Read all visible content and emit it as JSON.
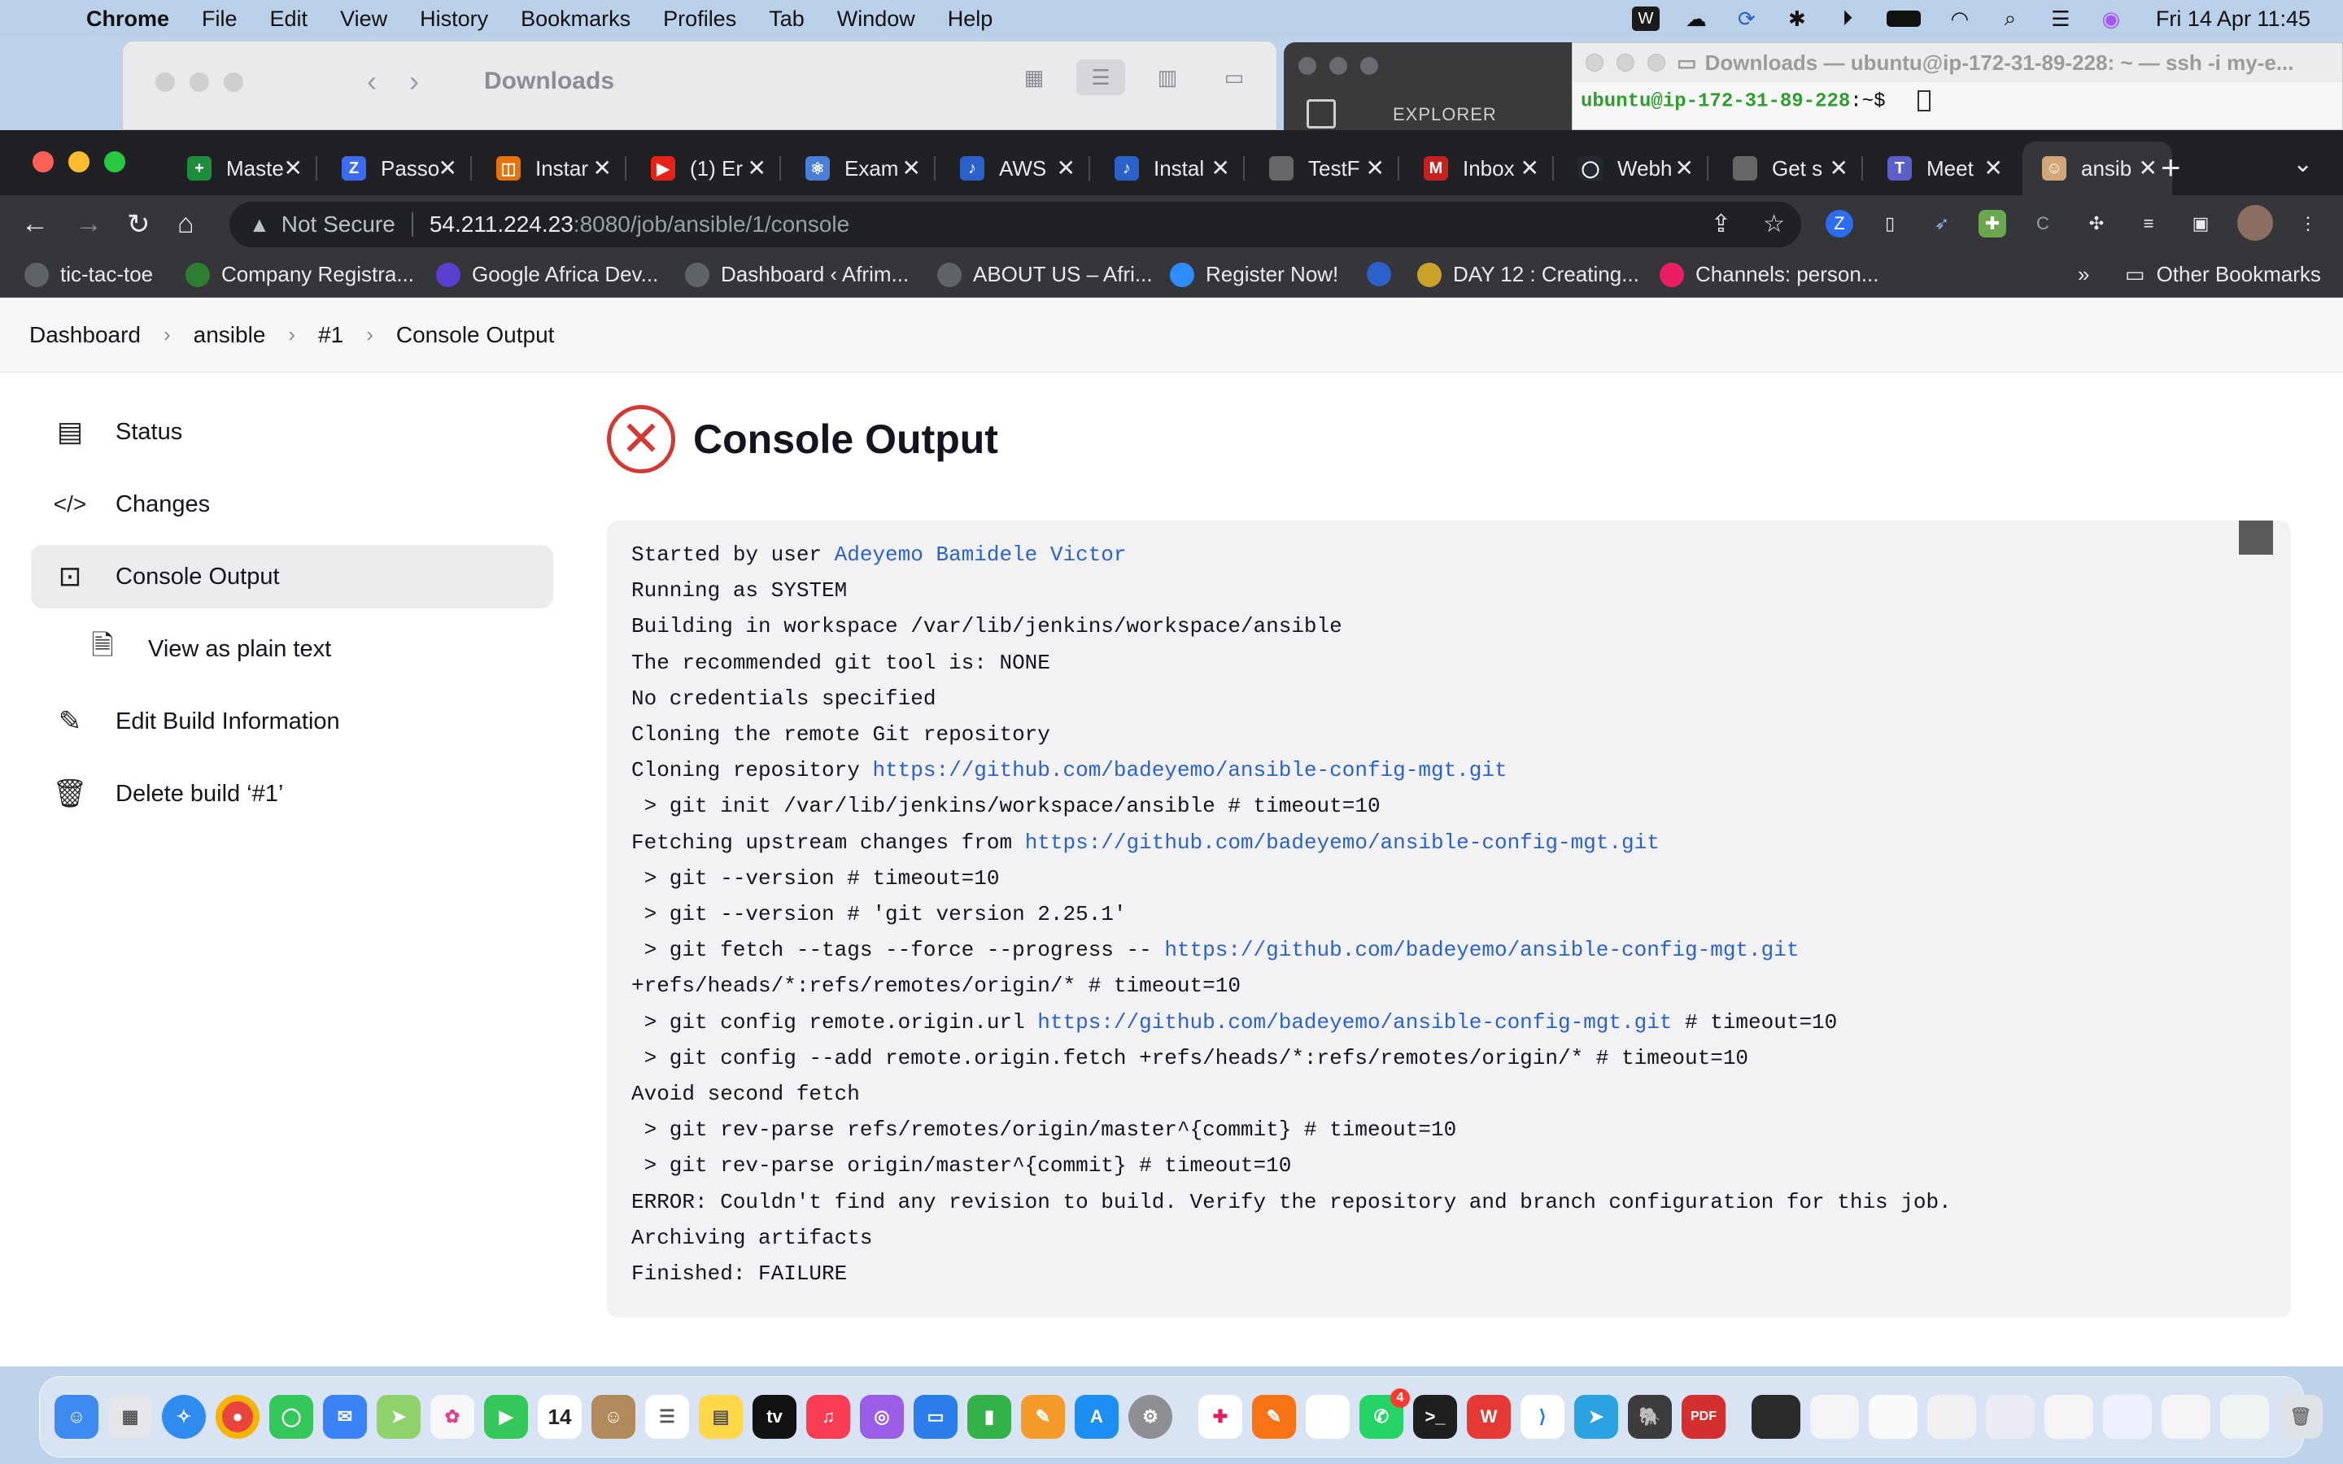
{
  "menubar": {
    "app": "Chrome",
    "items": [
      "File",
      "Edit",
      "View",
      "History",
      "Bookmarks",
      "Profiles",
      "Tab",
      "Window",
      "Help"
    ],
    "clock": "Fri 14 Apr  11:45"
  },
  "finder": {
    "title": "Downloads"
  },
  "vscode": {
    "explorer": "EXPLORER"
  },
  "terminal": {
    "title": "Downloads — ubuntu@ip-172-31-89-228: ~ — ssh -i my-e...",
    "prompt_user": "ubuntu@ip-172-31-89-228",
    "prompt_rest": ":~$"
  },
  "tabs": [
    {
      "label": "Maste",
      "color": "#1e8e3e",
      "glyph": "+"
    },
    {
      "label": "Passo",
      "color": "#3d6cf0",
      "glyph": "Z"
    },
    {
      "label": "Instar",
      "color": "#e8710a",
      "glyph": "◫"
    },
    {
      "label": "(1) Er",
      "color": "#e62117",
      "glyph": "▶"
    },
    {
      "label": "Exam",
      "color": "#4a7fd8",
      "glyph": "⚛"
    },
    {
      "label": "AWS",
      "color": "#2a62c9",
      "glyph": "♪"
    },
    {
      "label": "Instal",
      "color": "#2a62c9",
      "glyph": "♪"
    },
    {
      "label": "TestF",
      "color": "#666666",
      "glyph": ""
    },
    {
      "label": "Inbox",
      "color": "#c5221f",
      "glyph": "M"
    },
    {
      "label": "Webh",
      "color": "#24292f",
      "glyph": "◯"
    },
    {
      "label": "Get s",
      "color": "#666666",
      "glyph": ""
    },
    {
      "label": "Meet",
      "color": "#5b5fc7",
      "glyph": "T"
    },
    {
      "label": "ansib",
      "color": "#d2a679",
      "glyph": "☺"
    }
  ],
  "omnibox": {
    "security": "Not Secure",
    "host": "54.211.224.23",
    "path": ":8080/job/ansible/1/console"
  },
  "bookmarks": [
    {
      "label": "tic-tac-toe",
      "color": "#5f6368"
    },
    {
      "label": "Company Registra...",
      "color": "#2e7d32"
    },
    {
      "label": "Google Africa Dev...",
      "color": "#5b3fd1"
    },
    {
      "label": "Dashboard ‹ Afrim...",
      "color": "#5f6368"
    },
    {
      "label": "ABOUT US – Afri...",
      "color": "#5f6368"
    },
    {
      "label": "Register Now!",
      "color": "#2d8cff"
    },
    {
      "label": "",
      "color": "#2a62c9"
    },
    {
      "label": "DAY 12 : Creating...",
      "color": "#c9a227"
    },
    {
      "label": "Channels: person...",
      "color": "#e91e63"
    }
  ],
  "bookmarks_more": "»",
  "other_bookmarks": "Other Bookmarks",
  "breadcrumbs": [
    "Dashboard",
    "ansible",
    "#1",
    "Console Output"
  ],
  "sidebar": [
    {
      "label": "Status",
      "icon": "document-icon"
    },
    {
      "label": "Changes",
      "icon": "code-icon"
    },
    {
      "label": "Console Output",
      "icon": "terminal-icon"
    },
    {
      "label": "View as plain text",
      "icon": "file-icon"
    },
    {
      "label": "Edit Build Information",
      "icon": "edit-icon"
    },
    {
      "label": "Delete build ‘#1’",
      "icon": "trash-icon"
    }
  ],
  "page_title": "Console Output",
  "console_lines": [
    {
      "pre": "Started by user ",
      "link": "Adeyemo Bamidele Victor",
      "post": ""
    },
    {
      "pre": "Running as SYSTEM",
      "link": "",
      "post": ""
    },
    {
      "pre": "Building in workspace /var/lib/jenkins/workspace/ansible",
      "link": "",
      "post": ""
    },
    {
      "pre": "The recommended git tool is: NONE",
      "link": "",
      "post": ""
    },
    {
      "pre": "No credentials specified",
      "link": "",
      "post": ""
    },
    {
      "pre": "Cloning the remote Git repository",
      "link": "",
      "post": ""
    },
    {
      "pre": "Cloning repository ",
      "link": "https://github.com/badeyemo/ansible-config-mgt.git",
      "post": ""
    },
    {
      "pre": " > git init /var/lib/jenkins/workspace/ansible # timeout=10",
      "link": "",
      "post": ""
    },
    {
      "pre": "Fetching upstream changes from ",
      "link": "https://github.com/badeyemo/ansible-config-mgt.git",
      "post": ""
    },
    {
      "pre": " > git --version # timeout=10",
      "link": "",
      "post": ""
    },
    {
      "pre": " > git --version # 'git version 2.25.1'",
      "link": "",
      "post": ""
    },
    {
      "pre": " > git fetch --tags --force --progress -- ",
      "link": "https://github.com/badeyemo/ansible-config-mgt.git",
      "post": ""
    },
    {
      "pre": "+refs/heads/*:refs/remotes/origin/* # timeout=10",
      "link": "",
      "post": ""
    },
    {
      "pre": " > git config remote.origin.url ",
      "link": "https://github.com/badeyemo/ansible-config-mgt.git",
      "post": " # timeout=10"
    },
    {
      "pre": " > git config --add remote.origin.fetch +refs/heads/*:refs/remotes/origin/* # timeout=10",
      "link": "",
      "post": ""
    },
    {
      "pre": "Avoid second fetch",
      "link": "",
      "post": ""
    },
    {
      "pre": " > git rev-parse refs/remotes/origin/master^{commit} # timeout=10",
      "link": "",
      "post": ""
    },
    {
      "pre": " > git rev-parse origin/master^{commit} # timeout=10",
      "link": "",
      "post": ""
    },
    {
      "pre": "ERROR: Couldn't find any revision to build. Verify the repository and branch configuration for this job.",
      "link": "",
      "post": ""
    },
    {
      "pre": "Archiving artifacts",
      "link": "",
      "post": ""
    },
    {
      "pre": "Finished: FAILURE",
      "link": "",
      "post": ""
    }
  ],
  "calendar_day": "14",
  "dock_badge": "4",
  "colors": {
    "fail_red": "#d33833",
    "link_blue": "#2a62c9",
    "chrome_dark": "#202124",
    "chrome_toolbar": "#35363a"
  }
}
